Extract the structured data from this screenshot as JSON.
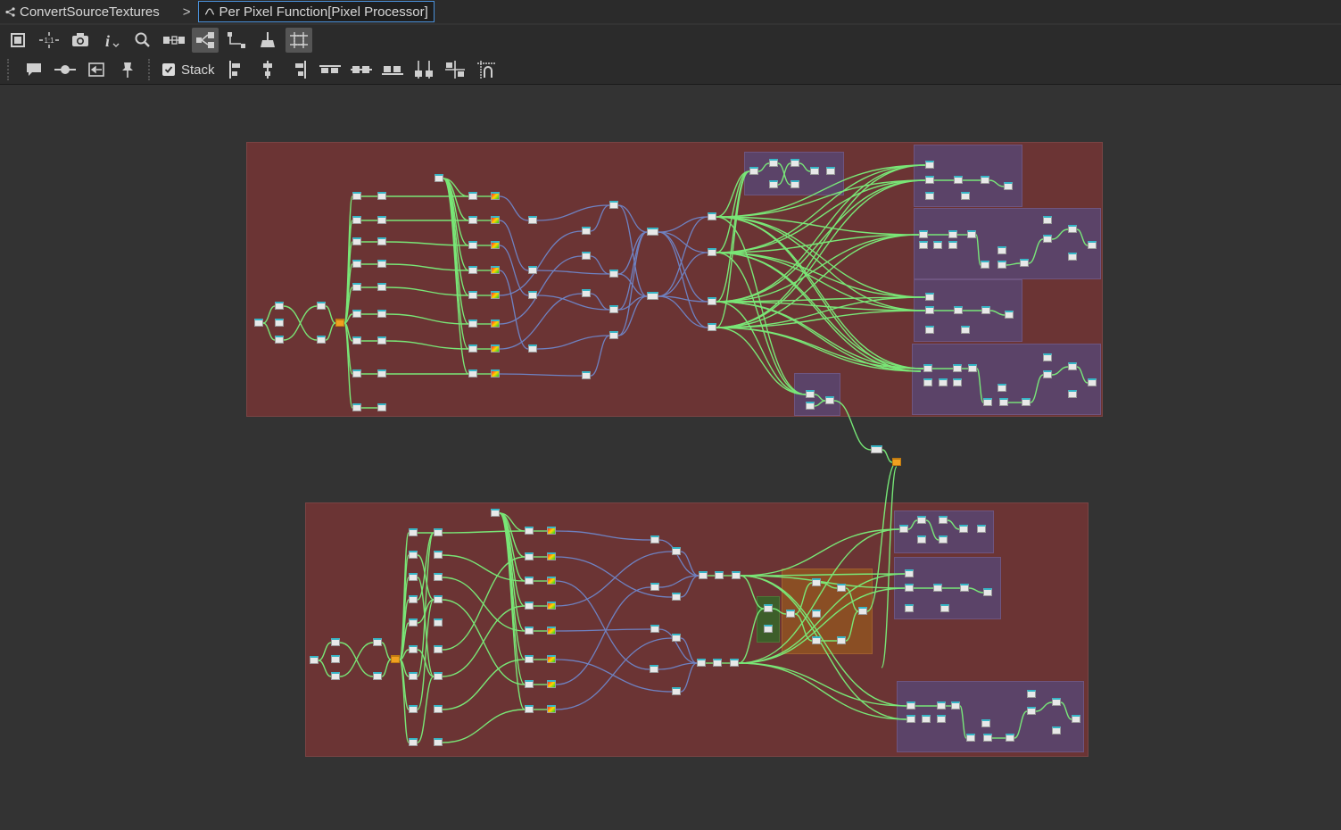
{
  "breadcrumb": {
    "items": [
      {
        "label": "ConvertSourceTextures",
        "icon": "graph-icon"
      },
      {
        "label": "Per Pixel Function[Pixel Processor]",
        "icon": "function-icon"
      }
    ],
    "separator": ">"
  },
  "toolbar_top": {
    "buttons": [
      "frame-all-icon",
      "fit-1to1-icon",
      "camera-icon",
      "info-icon",
      "search-icon",
      "align-node-icon",
      "graph-layout-icon",
      "connector-icon",
      "clean-icon",
      "snap-grid-icon"
    ],
    "selected": [
      "graph-layout-icon",
      "snap-grid-icon"
    ]
  },
  "toolbar_bottom": {
    "buttons_left": [
      "comment-icon",
      "dot-node-icon",
      "frame-node-icon",
      "pin-icon"
    ],
    "stack_label": "Stack",
    "stack_checked": true,
    "buttons_right": [
      "align-left-icon",
      "align-center-icon",
      "align-right-icon",
      "align-top-icon",
      "align-middle-icon",
      "align-bottom-icon",
      "distribute-h-icon",
      "distribute-v-icon",
      "snap-icon"
    ]
  },
  "colors": {
    "background": "#333333",
    "toolbar": "#2b2b2b",
    "frame": "#6b3434",
    "subframe": "#5b4368",
    "orange_frame": "#8a4e24",
    "wire_green": "#7af07a",
    "wire_blue": "#6f86c9",
    "accent": "#4a90d9"
  }
}
